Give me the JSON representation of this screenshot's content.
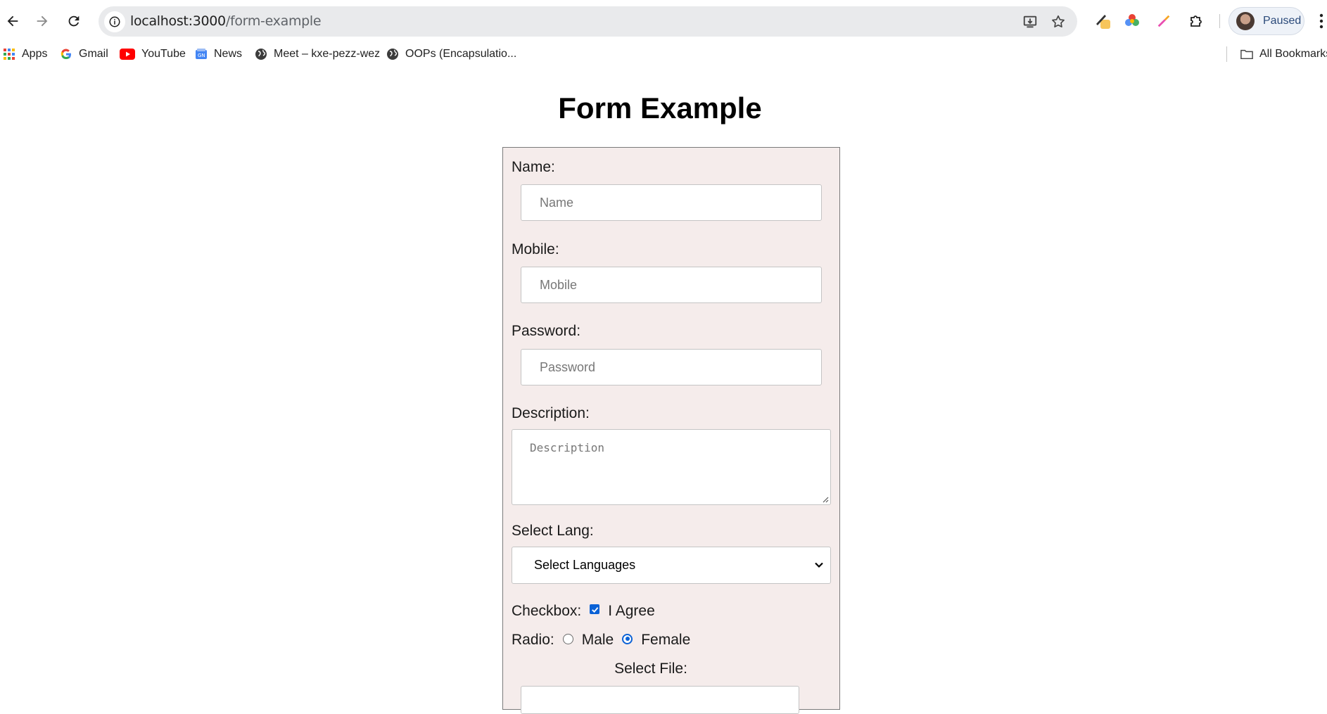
{
  "browser": {
    "url_host": "localhost:3000",
    "url_path": "/form-example",
    "profile_label": "Paused",
    "bookmarks": [
      {
        "label": "Apps",
        "icon": "apps-grid-icon"
      },
      {
        "label": "Gmail",
        "icon": "google-icon"
      },
      {
        "label": "YouTube",
        "icon": "youtube-icon"
      },
      {
        "label": "News",
        "icon": "news-icon"
      },
      {
        "label": "Meet – kxe-pezz-wez",
        "icon": "globe-icon"
      },
      {
        "label": "OOPs (Encapsulatio...",
        "icon": "globe-icon"
      }
    ],
    "all_bookmarks_label": "All Bookmarks"
  },
  "page": {
    "title": "Form Example",
    "form": {
      "name_label": "Name:",
      "name_placeholder": "Name",
      "mobile_label": "Mobile:",
      "mobile_placeholder": "Mobile",
      "password_label": "Password:",
      "password_placeholder": "Password",
      "description_label": "Description:",
      "description_placeholder": "Description",
      "lang_label": "Select Lang:",
      "lang_selected": "Select Languages",
      "checkbox_label": "Checkbox:",
      "checkbox_text": "I Agree",
      "checkbox_checked": true,
      "radio_label": "Radio:",
      "radio_options": [
        "Male",
        "Female"
      ],
      "radio_selected": "Female",
      "file_label": "Select File:"
    }
  },
  "colors": {
    "form_bg": "#f5eceb",
    "accent": "#0b62d6"
  }
}
